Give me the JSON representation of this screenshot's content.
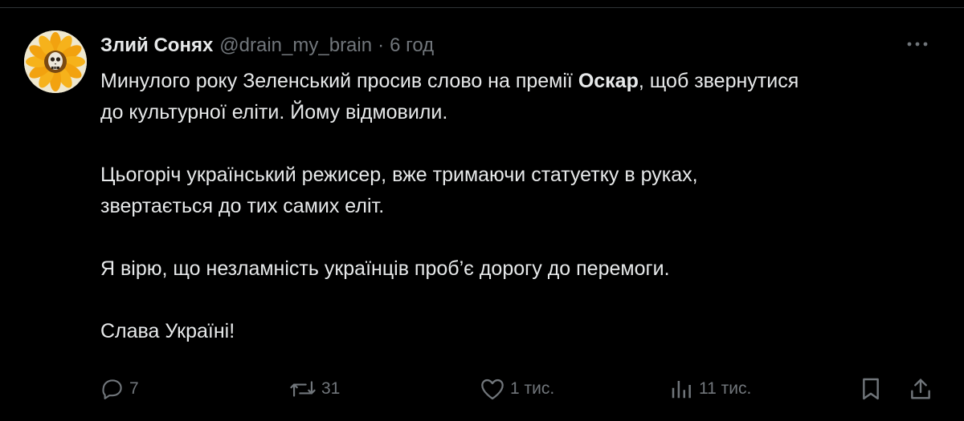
{
  "tweet": {
    "author_name": "Злий Сонях",
    "handle": "@drain_my_brain",
    "separator": "·",
    "time": "6 год",
    "text": {
      "p1_before": "Минулого року Зеленський просив слово на премії ",
      "p1_bold": "Оскар",
      "p1_after": ", щоб звернутися",
      "p1_line2": "до культурної еліти. Йому відмовили.",
      "p2_line1": "Цьогоріч український режисер, вже тримаючи статуетку в руках,",
      "p2_line2": "звертається до тих самих еліт.",
      "p3": "Я вірю, що незламність українців проб’є дорогу до перемоги.",
      "p4": "Слава Україні!"
    },
    "actions": {
      "replies": "7",
      "reposts": "31",
      "likes": "1 тис.",
      "views": "11 тис."
    }
  },
  "icons": {
    "avatar": "sunflower-skull-avatar",
    "more": "more-dots-icon",
    "reply": "reply-icon",
    "repost": "repost-icon",
    "like": "heart-icon",
    "views": "views-chart-icon",
    "bookmark": "bookmark-icon",
    "share": "share-icon"
  },
  "colors": {
    "background": "#000000",
    "text": "#e7e9ea",
    "secondary": "#71767b",
    "border": "#2f3336"
  }
}
